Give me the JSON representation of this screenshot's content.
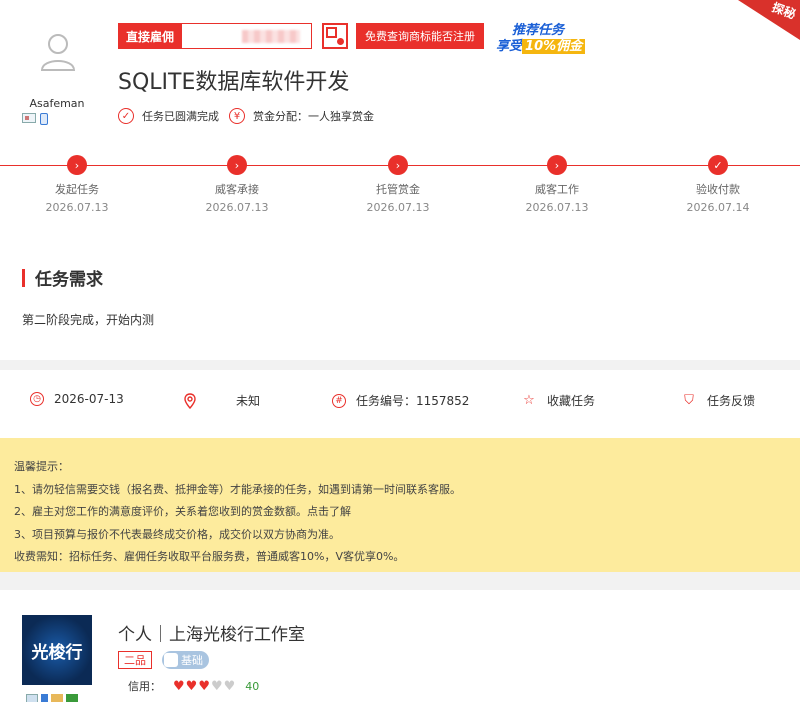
{
  "employer": {
    "name": "Asafeman"
  },
  "tags": {
    "direct_hire": "直接雇佣",
    "free_check": "免费查询商标能否注册",
    "promo_line1": "推荐任务",
    "promo_line2_prefix": "享受",
    "promo_line2_highlight": "10%佣金",
    "corner": "探秘"
  },
  "task": {
    "title": "SQLITE数据库软件开发",
    "status": "任务已圆满完成",
    "reward_mode": "赏金分配：一人独享赏金",
    "check_icon": "check-circle-icon",
    "yen_icon": "yen-circle-icon"
  },
  "progress": {
    "steps": [
      {
        "label": "发起任务",
        "date": "2026.07.13",
        "icon": "chevron-right-icon"
      },
      {
        "label": "威客承接",
        "date": "2026.07.13",
        "icon": "chevron-right-icon"
      },
      {
        "label": "托管赏金",
        "date": "2026.07.13",
        "icon": "chevron-right-icon"
      },
      {
        "label": "威客工作",
        "date": "2026.07.13",
        "icon": "chevron-right-icon"
      },
      {
        "label": "验收付款",
        "date": "2026.07.14",
        "icon": "check-icon"
      }
    ]
  },
  "demand": {
    "heading": "任务需求",
    "text": "第二阶段完成，开始内测"
  },
  "info": {
    "date": "2026-07-13",
    "location": "未知",
    "task_no": "任务编号：1157852",
    "favorite": "收藏任务",
    "feedback": "任务反馈"
  },
  "notice": {
    "lines": [
      "温馨提示：",
      "1、请勿轻信需要交钱（报名费、抵押金等）才能承接的任务，如遇到请第一时间联系客服。",
      "2、雇主对您工作的满意度评价，关系着您收到的赏金数额。点击了解",
      "3、项目预算与报价不代表最终成交价格，成交价以双方协商为准。",
      "收费需知：招标任务、雇佣任务收取平台服务费，普通威客10%，V客优享0%。"
    ]
  },
  "company": {
    "logo_text": "光梭行",
    "name": "个人｜上海光梭行工作室",
    "level": "二品",
    "tier": "基础",
    "credit_label": "信用：",
    "credit_hearts_filled": 3,
    "credit_hearts_total": 5,
    "credit_score": "40"
  },
  "colors": {
    "accent": "#e9302b",
    "notice_bg": "#fdeb9d",
    "score": "#3a9a3a"
  }
}
